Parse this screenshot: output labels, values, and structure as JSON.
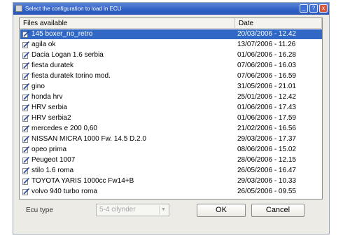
{
  "window": {
    "title": "Select the configuration to load in ECU"
  },
  "titlebar_buttons": {
    "minimize": "_",
    "help": "?",
    "close": "x"
  },
  "list": {
    "headers": {
      "file": "Files available",
      "date": "Date"
    },
    "selected_index": 0,
    "rows": [
      {
        "name": "145 boxer_no_retro",
        "date": "20/03/2006 - 12.42"
      },
      {
        "name": "agila ok",
        "date": "13/07/2006 - 11.26"
      },
      {
        "name": "Dacia Logan 1.6 serbia",
        "date": "01/06/2006 - 16.28"
      },
      {
        "name": "fiesta duratek",
        "date": "07/06/2006 - 16.03"
      },
      {
        "name": "fiesta duratek torino mod.",
        "date": "07/06/2006 - 16.59"
      },
      {
        "name": "gino",
        "date": "31/05/2006 - 21.01"
      },
      {
        "name": "honda hrv",
        "date": "25/01/2006 - 12.42"
      },
      {
        "name": "HRV serbia",
        "date": "01/06/2006 - 17.43"
      },
      {
        "name": "HRV serbia2",
        "date": "01/06/2006 - 17.59"
      },
      {
        "name": "mercedes e 200 0,60",
        "date": "21/02/2006 - 16.56"
      },
      {
        "name": "NISSAN MICRA 1000 Fw. 14.5 D.2.0",
        "date": "29/03/2006 - 17.37"
      },
      {
        "name": "opeo prima",
        "date": "08/06/2006 - 15.02"
      },
      {
        "name": "Peugeot 1007",
        "date": "28/06/2006 - 12.15"
      },
      {
        "name": "stilo 1.6 roma",
        "date": "26/05/2006 - 16.47"
      },
      {
        "name": "TOYOTA YARIS 1000cc Fw14+B",
        "date": "29/03/2006 - 10.33"
      },
      {
        "name": "volvo 940 turbo roma",
        "date": "26/05/2006 - 09.55"
      }
    ]
  },
  "ecu": {
    "label": "Ecu type",
    "value": "5-4 cilynder"
  },
  "buttons": {
    "ok": "OK",
    "cancel": "Cancel"
  },
  "colors": {
    "selection": "#3168c6",
    "titlebar": "#2f5fc4"
  },
  "icons": {
    "file_row": "file-pencil-icon",
    "window": "app-icon"
  }
}
